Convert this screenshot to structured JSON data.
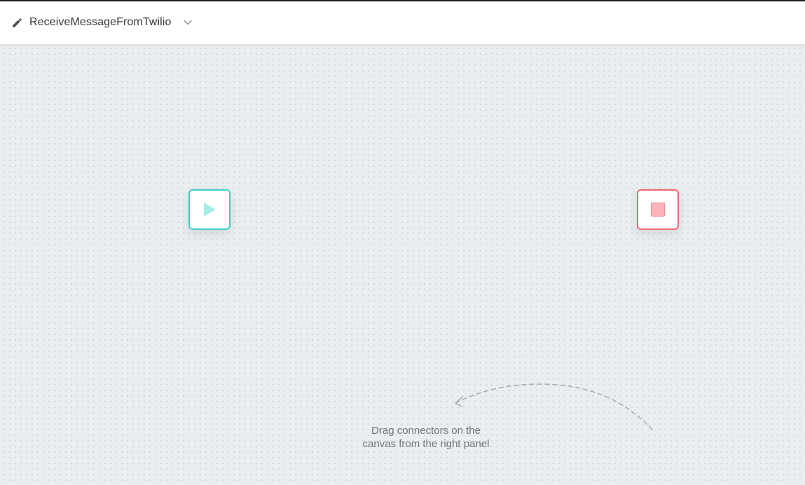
{
  "header": {
    "flow_name": "ReceiveMessageFromTwilio",
    "edit_icon": "pencil-icon",
    "dropdown_icon": "chevron-down-icon"
  },
  "canvas": {
    "start_node": {
      "icon": "play-icon",
      "color": "#3ccfc4"
    },
    "end_node": {
      "icon": "stop-icon",
      "color": "#ef6a6f"
    },
    "hint": {
      "line1": "Drag connectors on the",
      "line2": "canvas from the right panel",
      "arrow_icon": "dashed-curved-arrow-icon"
    }
  },
  "colors": {
    "header_background": "#ffffff",
    "canvas_background": "#ebeef1",
    "title_text": "#33373d",
    "hint_text": "#6f747a"
  }
}
